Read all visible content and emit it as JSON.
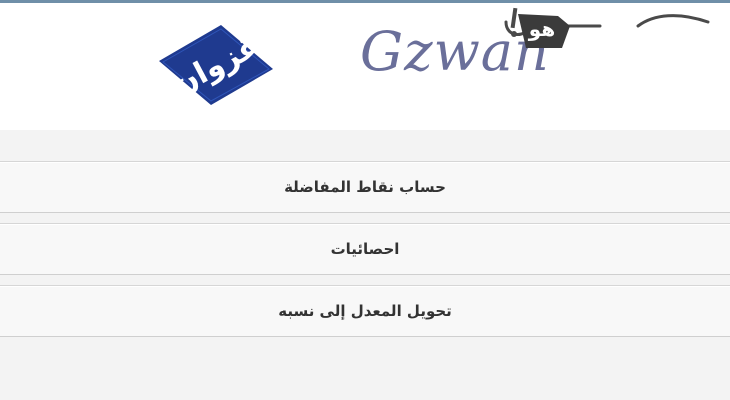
{
  "header": {
    "logo_arabic": "غزوان",
    "logo_text": "Gzwan",
    "watermark": "هو",
    "brand_color": "#1f3a8f"
  },
  "menu": {
    "items": [
      {
        "label": "حساب نقاط المفاضلة"
      },
      {
        "label": "احصائيات"
      },
      {
        "label": "تحويل المعدل إلى نسبه"
      }
    ]
  }
}
